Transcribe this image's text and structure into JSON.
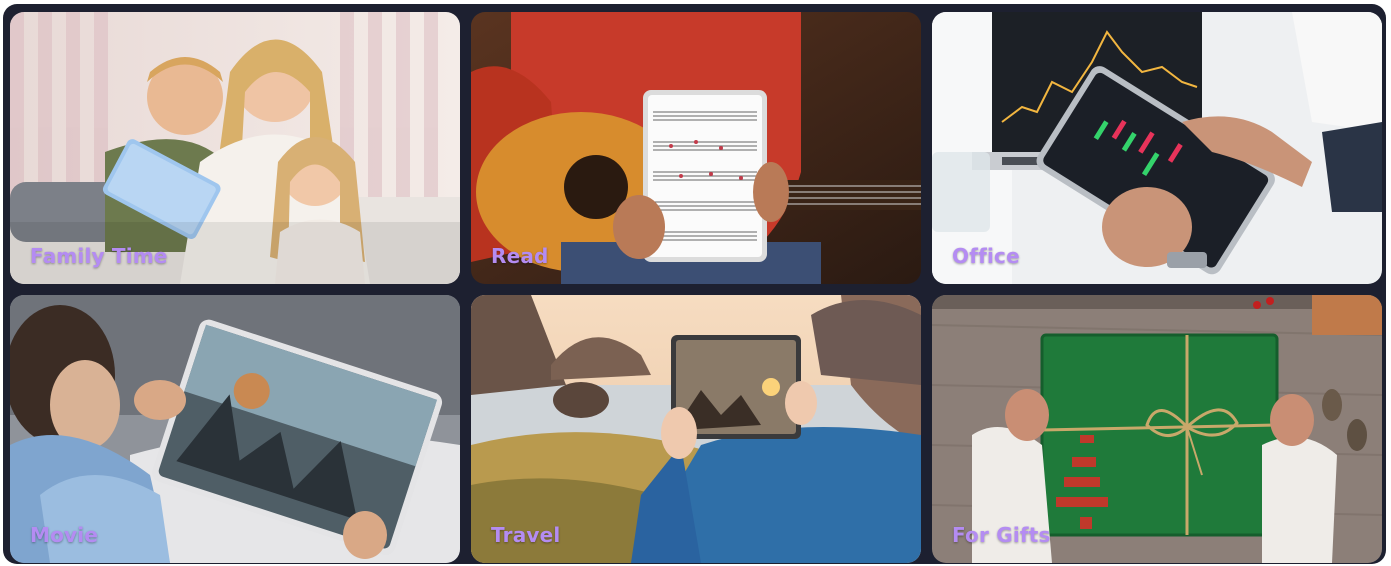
{
  "tiles": [
    {
      "label": "Family Time"
    },
    {
      "label": "Read"
    },
    {
      "label": "Office"
    },
    {
      "label": "Movie"
    },
    {
      "label": "Travel"
    },
    {
      "label": "For Gifts"
    }
  ]
}
